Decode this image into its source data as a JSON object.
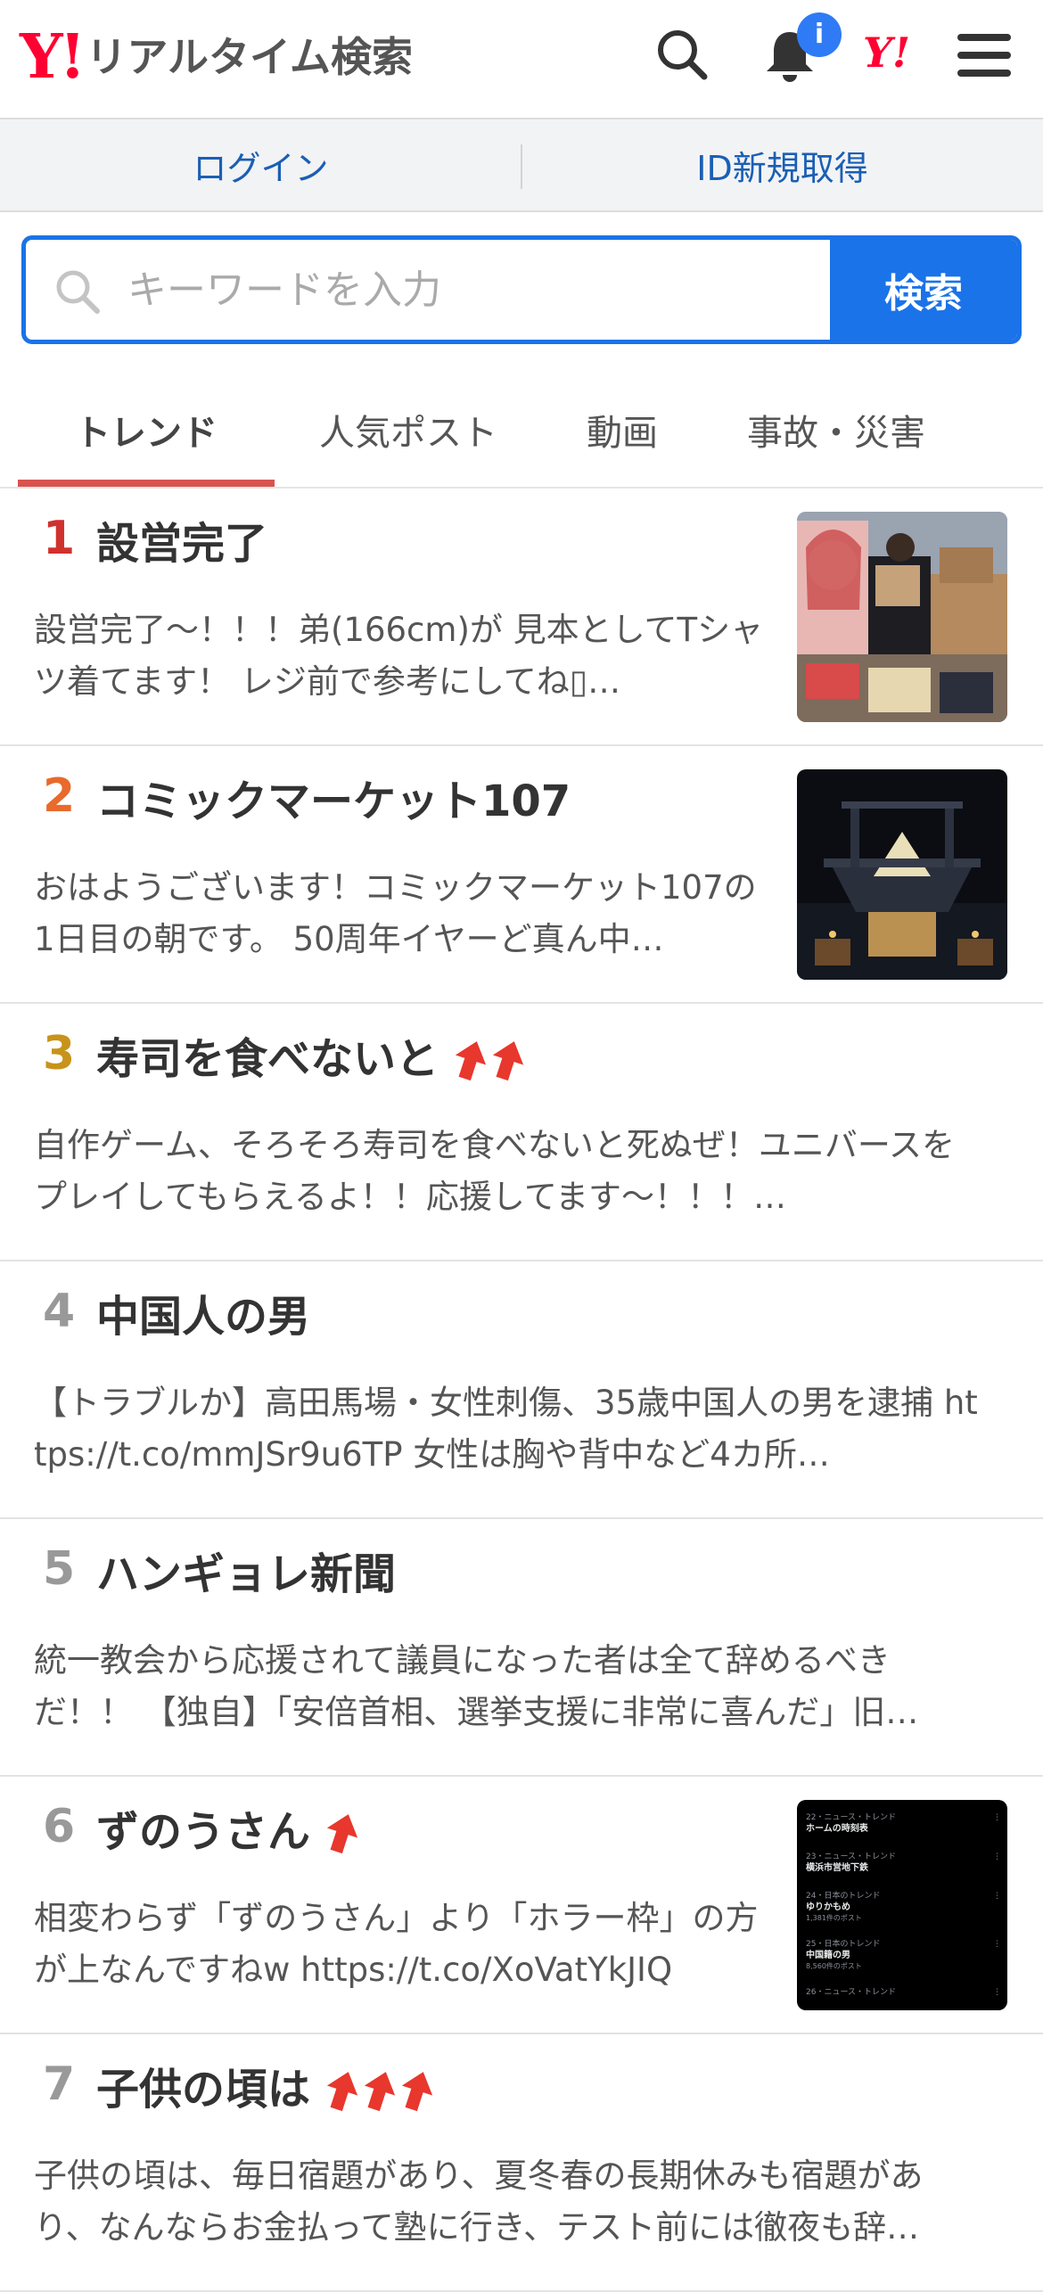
{
  "header": {
    "logo_mark": "Y!",
    "logo_text": "リアルタイム検索",
    "notification_badge": "i",
    "yahoo_mark": "Y!"
  },
  "login": {
    "login_label": "ログイン",
    "register_label": "ID新規取得"
  },
  "search": {
    "placeholder": "キーワードを入力",
    "button_label": "検索"
  },
  "tabs": [
    {
      "label": "トレンド",
      "active": true
    },
    {
      "label": "人気ポスト",
      "active": false
    },
    {
      "label": "動画",
      "active": false
    },
    {
      "label": "事故・災害",
      "active": false
    }
  ],
  "trends": [
    {
      "rank": "1",
      "title": "設営完了",
      "arrows": 0,
      "rank_color": "#d0312d",
      "snippet": "設営完了～！！！弟(166cm)が 見本としてTシャツ着てます！ レジ前で参考にしてね▯…",
      "thumb": "merch"
    },
    {
      "rank": "2",
      "title": "コミックマーケット107",
      "arrows": 0,
      "rank_color": "#e86a2c",
      "snippet": "おはようございます！コミックマーケット107の1日目の朝です。 50周年イヤーど真ん中…",
      "thumb": "building"
    },
    {
      "rank": "3",
      "title": "寿司を食べないと",
      "arrows": 2,
      "rank_color": "#c8931a",
      "snippet": "自作ゲーム、そろそろ寿司を食べないと死ぬぜ！ユニバースをプレイしてもらえるよ！！応援してます～！！！…",
      "thumb": null
    },
    {
      "rank": "4",
      "title": "中国人の男",
      "arrows": 0,
      "rank_color": "#999999",
      "snippet": "【トラブルか】高田馬場・女性刺傷、35歳中国人の男を逮捕 https://t.co/mmJSr9u6TP 女性は胸や背中など4カ所…",
      "thumb": null
    },
    {
      "rank": "5",
      "title": "ハンギョレ新聞",
      "arrows": 0,
      "rank_color": "#999999",
      "snippet": "統一教会から応援されて議員になった者は全て辞めるべきだ！！ 【独自】「安倍首相、選挙支援に非常に喜んだ」旧…",
      "thumb": null
    },
    {
      "rank": "6",
      "title": "ずのうさん",
      "arrows": 1,
      "rank_color": "#999999",
      "snippet": "相変わらず「ずのうさん」より「ホラー枠」の方が上なんですねw https://t.co/XoVatYkJIQ",
      "thumb": "screenshot"
    },
    {
      "rank": "7",
      "title": "子供の頃は",
      "arrows": 3,
      "rank_color": "#999999",
      "snippet": "子供の頃は、毎日宿題があり、夏冬春の長期休みも宿題があり、なんならお金払って塾に行き、テスト前には徹夜も辞…",
      "thumb": null
    }
  ],
  "screenshot_thumb_lines": [
    {
      "meta": "22・ニュース・トレンド",
      "title": "ホームの時刻表"
    },
    {
      "meta": "23・ニュース・トレンド",
      "title": "横浜市営地下鉄"
    },
    {
      "meta": "24・日本のトレンド",
      "title": "ゆりかもめ",
      "sub": "1,381件のポスト"
    },
    {
      "meta": "25・日本のトレンド",
      "title": "中国籍の男",
      "sub": "8,560件のポスト"
    },
    {
      "meta": "26・ニュース・トレンド",
      "title": ""
    }
  ],
  "colors": {
    "brand_red": "#ff0033",
    "accent_blue": "#1a73e8",
    "link_blue": "#1a5fb4",
    "tab_underline": "#d9534f",
    "trend_arrow": "#e8372d"
  }
}
